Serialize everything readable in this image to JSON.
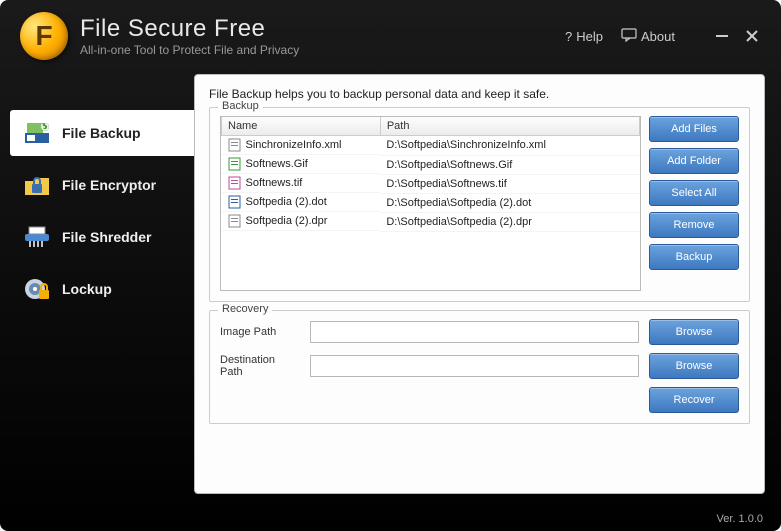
{
  "header": {
    "logo_letter": "F",
    "title": "File Secure Free",
    "subtitle": "All-in-one Tool to Protect File and Privacy",
    "help": "Help",
    "about": "About"
  },
  "sidebar": {
    "items": [
      {
        "label": "File Backup"
      },
      {
        "label": "File Encryptor"
      },
      {
        "label": "File Shredder"
      },
      {
        "label": "Lockup"
      }
    ]
  },
  "main": {
    "description": "File Backup helps you to backup personal data and keep it safe.",
    "backup_legend": "Backup",
    "recovery_legend": "Recovery",
    "columns": {
      "name": "Name",
      "path": "Path"
    },
    "files": [
      {
        "name": "SinchronizeInfo.xml",
        "path": "D:\\Softpedia\\SinchronizeInfo.xml"
      },
      {
        "name": "Softnews.Gif",
        "path": "D:\\Softpedia\\Softnews.Gif"
      },
      {
        "name": "Softnews.tif",
        "path": "D:\\Softpedia\\Softnews.tif"
      },
      {
        "name": "Softpedia (2).dot",
        "path": "D:\\Softpedia\\Softpedia (2).dot"
      },
      {
        "name": "Softpedia (2).dpr",
        "path": "D:\\Softpedia\\Softpedia (2).dpr"
      }
    ],
    "buttons": {
      "add_files": "Add Files",
      "add_folder": "Add Folder",
      "select_all": "Select All",
      "remove": "Remove",
      "backup": "Backup",
      "browse": "Browse",
      "recover": "Recover"
    },
    "recovery": {
      "image_path_label": "Image Path",
      "image_path_value": "",
      "destination_label": "Destination Path",
      "destination_value": ""
    }
  },
  "footer": {
    "version": "Ver. 1.0.0"
  }
}
